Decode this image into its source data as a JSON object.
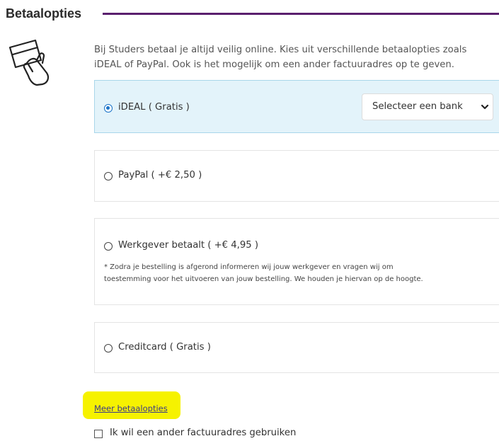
{
  "section": {
    "title": "Betaalopties"
  },
  "intro": {
    "line1": "Bij Studers betaal je altijd veilig online. Kies uit verschillende betaalopties zoals",
    "line2": "iDEAL of PayPal. Ook is het mogelijk om een ander factuuradres op te geven."
  },
  "icons": {
    "payment": "hand-holding-card-icon",
    "dropdown": "chevron-down-icon"
  },
  "options": [
    {
      "label": "iDEAL ( Gratis )",
      "selected": true
    },
    {
      "label": "PayPal ( +€ 2,50 )",
      "selected": false
    },
    {
      "label": "Werkgever betaalt ( +€ 4,95 )",
      "selected": false
    },
    {
      "label": "Creditcard ( Gratis )",
      "selected": false
    }
  ],
  "bank_select": {
    "value": "Selecteer een bank"
  },
  "employer_note": {
    "line1": "* Zodra je bestelling is afgerond informeren wij jouw werkgever en vragen wij om",
    "line2": "toestemming voor het uitvoeren van jouw bestelling. We houden je hiervan op de hoogte."
  },
  "more_link": "Meer betaalopties",
  "billing_checkbox": {
    "label": "Ik wil een ander factuuradres gebruiken",
    "checked": false
  },
  "colors": {
    "title_rule": "#5a1f6e",
    "selected_bg": "#e3f3fa",
    "highlight": "#f6f200",
    "radio_accent": "#1a73c8"
  }
}
